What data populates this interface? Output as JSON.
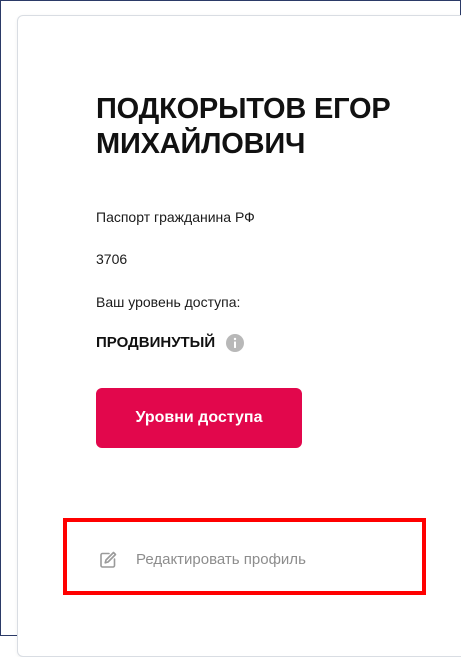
{
  "profile": {
    "full_name": "ПОДКОРЫТОВ ЕГОР МИХАЙЛОВИЧ",
    "document_type": "Паспорт гражданина РФ",
    "document_number": "3706",
    "access_level_label": "Ваш уровень доступа:",
    "access_level_value": "ПРОДВИНУТЫЙ"
  },
  "actions": {
    "access_levels_button": "Уровни доступа",
    "edit_profile_link": "Редактировать профиль"
  },
  "icons": {
    "info": "info-icon",
    "edit": "pencil-edit-icon"
  },
  "colors": {
    "accent": "#e2074c",
    "highlight": "#ff0000",
    "muted_text": "#8d8d8d"
  }
}
